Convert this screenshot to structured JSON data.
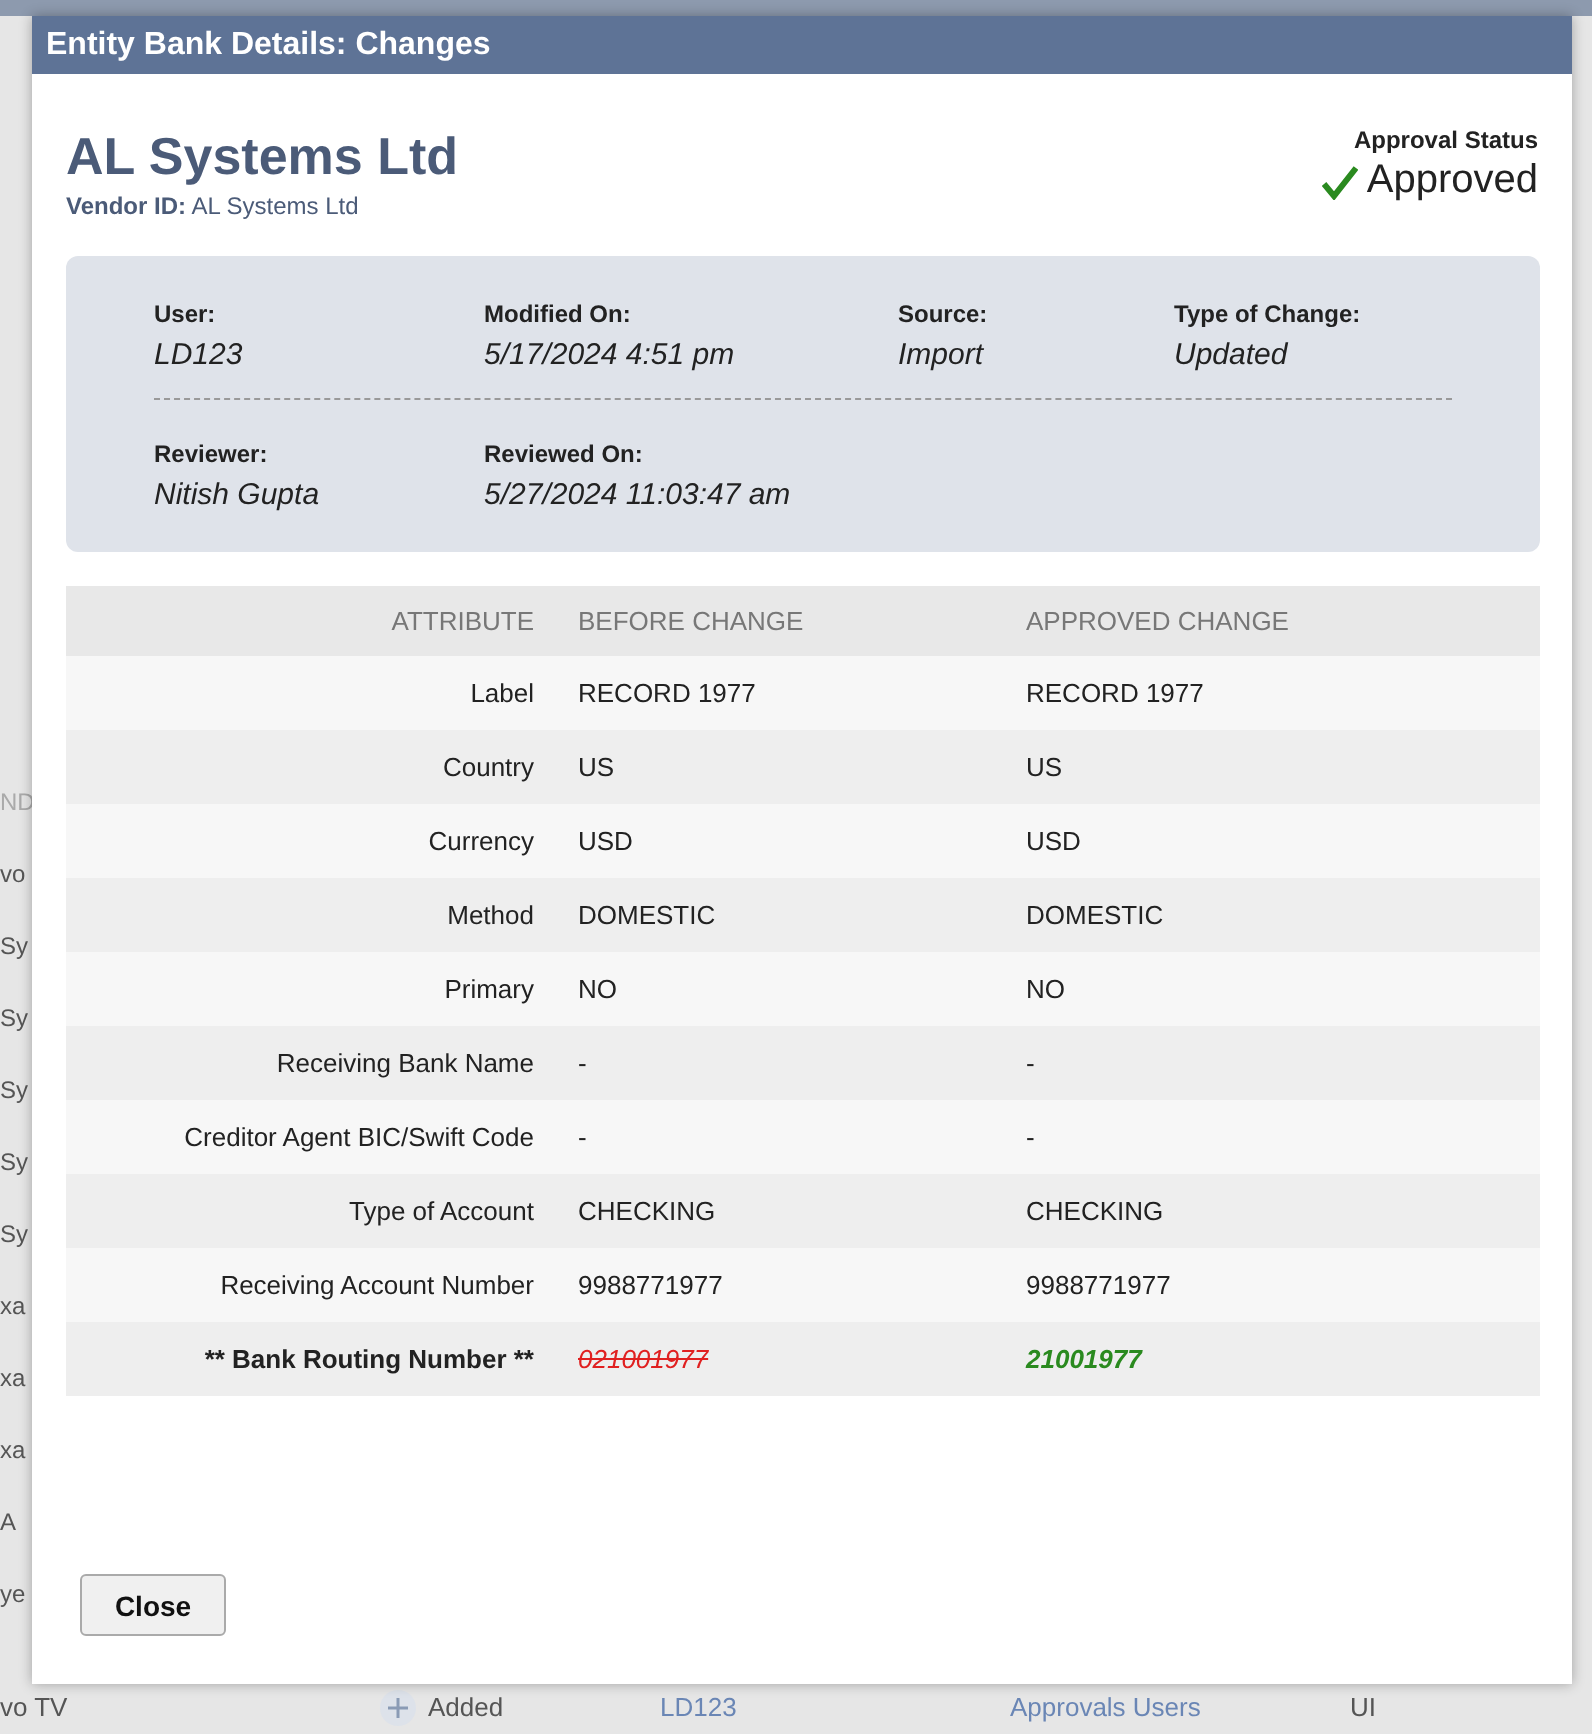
{
  "background": {
    "column_fragments": [
      "ND",
      "vo",
      "Sy",
      "Sy",
      "Sy",
      "Sy",
      "Sy",
      "xa",
      "xa",
      "xa",
      "A",
      "ye"
    ],
    "last_row": {
      "name": "vo TV",
      "change": "Added",
      "user": "LD123",
      "source": "Approvals Users",
      "type": "UI"
    }
  },
  "dialog": {
    "title": "Entity Bank Details: Changes",
    "entity_name": "AL Systems Ltd",
    "vendor_id_label": "Vendor ID:",
    "vendor_id": "AL Systems Ltd",
    "approval_status": {
      "label": "Approval Status",
      "value": "Approved",
      "approved": true
    },
    "details": [
      {
        "label": "User:",
        "value": "LD123"
      },
      {
        "label": "Modified On:",
        "value": "5/17/2024 4:51 pm"
      },
      {
        "label": "Source:",
        "value": "Import"
      },
      {
        "label": "Type of Change:",
        "value": "Updated"
      }
    ],
    "review": [
      {
        "label": "Reviewer:",
        "value": "Nitish Gupta"
      },
      {
        "label": "Reviewed On:",
        "value": "5/27/2024 11:03:47 am"
      }
    ],
    "table": {
      "columns": [
        "ATTRIBUTE",
        "BEFORE CHANGE",
        "APPROVED CHANGE"
      ],
      "rows": [
        {
          "attribute": "Label",
          "before": "RECORD 1977",
          "after": "RECORD 1977",
          "changed": false
        },
        {
          "attribute": "Country",
          "before": "US",
          "after": "US",
          "changed": false
        },
        {
          "attribute": "Currency",
          "before": "USD",
          "after": "USD",
          "changed": false
        },
        {
          "attribute": "Method",
          "before": "DOMESTIC",
          "after": "DOMESTIC",
          "changed": false
        },
        {
          "attribute": "Primary",
          "before": "NO",
          "after": "NO",
          "changed": false
        },
        {
          "attribute": "Receiving Bank Name",
          "before": "-",
          "after": "-",
          "changed": false
        },
        {
          "attribute": "Creditor Agent BIC/Swift Code",
          "before": "-",
          "after": "-",
          "changed": false
        },
        {
          "attribute": "Type of Account",
          "before": "CHECKING",
          "after": "CHECKING",
          "changed": false
        },
        {
          "attribute": "Receiving Account Number",
          "before": "9988771977",
          "after": "9988771977",
          "changed": false
        },
        {
          "attribute": "** Bank Routing Number **",
          "before": "021001977",
          "after": "21001977",
          "changed": true
        }
      ]
    },
    "buttons": [
      "Close"
    ]
  }
}
